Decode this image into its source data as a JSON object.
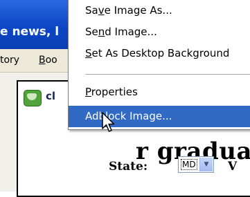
{
  "browser": {
    "title_text": "e news, l",
    "menus": [
      {
        "pre": "",
        "key": "",
        "post": "tory"
      },
      {
        "pre": "",
        "key": "B",
        "post": "oo"
      }
    ]
  },
  "page": {
    "site_logo_text": "cl",
    "heading_fragment": "r gradua",
    "state_label": "State:",
    "state_value": "MD",
    "trailing_letter": "V"
  },
  "context_menu": {
    "items": [
      {
        "pre": "Sa",
        "key": "v",
        "post": "e Image As..."
      },
      {
        "pre": "Se",
        "key": "n",
        "post": "d Image..."
      },
      {
        "pre": "",
        "key": "S",
        "post": "et As Desktop Background"
      },
      {
        "pre": "",
        "key": "P",
        "post": "roperties"
      },
      {
        "pre": "Adblock Image...",
        "key": "",
        "post": ""
      }
    ],
    "highlight_color": "#316ac5"
  },
  "colors": {
    "titlebar": "#0b46c6",
    "menubar": "#ece9d8"
  }
}
